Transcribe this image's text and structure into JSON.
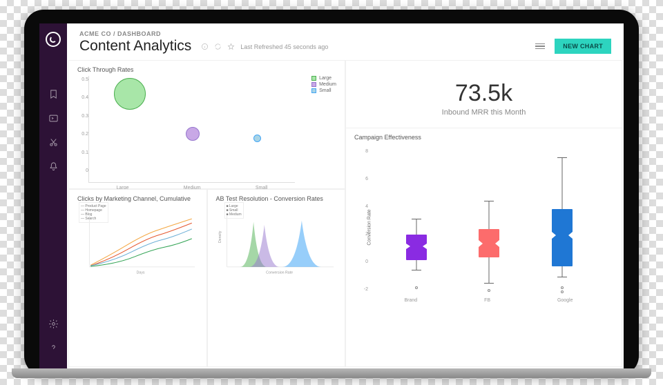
{
  "breadcrumb": {
    "company": "ACME CO",
    "section": "DASHBOARD"
  },
  "title": "Content Analytics",
  "refresh_label": "Last Refreshed 45 seconds ago",
  "new_chart_btn": "NEW CHART",
  "kpi": {
    "value": "73.5k",
    "label": "Inbound MRR this Month"
  },
  "ctr": {
    "title": "Click Through Rates",
    "y_ticks": [
      "0.5",
      "0.4",
      "0.3",
      "0.2",
      "0.1",
      "0"
    ],
    "x_labels": [
      "Large",
      "Medium",
      "Small"
    ],
    "legend": [
      {
        "name": "Large",
        "fill": "#a8e6a8",
        "stroke": "#4caf50"
      },
      {
        "name": "Medium",
        "fill": "#c8a8e6",
        "stroke": "#9575cd"
      },
      {
        "name": "Small",
        "fill": "#a8d4e6",
        "stroke": "#42a5f5"
      }
    ]
  },
  "clicks": {
    "title": "Clicks by Marketing Channel, Cumulative",
    "xlabel": "Days",
    "legend": [
      "Product Page",
      "Homepage",
      "Blog",
      "Search"
    ]
  },
  "abtest": {
    "title": "AB Test Resolution - Conversion Rates",
    "xlabel": "Conversion Rate",
    "legend": [
      "Large",
      "Small",
      "Medium"
    ]
  },
  "campaign": {
    "title": "Campaign Effectiveness",
    "y_label": "Conversion Rate",
    "y_ticks": [
      "8",
      "6",
      "4",
      "2",
      "0",
      "-2"
    ],
    "x_labels": [
      "Brand",
      "FB",
      "Google"
    ]
  },
  "chart_data": [
    {
      "type": "scatter",
      "title": "Click Through Rates",
      "x": [
        "Large",
        "Medium",
        "Small"
      ],
      "y": [
        0.44,
        0.24,
        0.21
      ],
      "sizes": [
        50,
        22,
        12
      ],
      "ylim": [
        0,
        0.5
      ]
    },
    {
      "type": "line",
      "title": "Clicks by Marketing Channel, Cumulative",
      "series": [
        {
          "name": "Product Page",
          "color": "#f4a742",
          "values": [
            600,
            1200,
            2100,
            2800,
            3400,
            4300,
            5100,
            5600,
            6200
          ]
        },
        {
          "name": "Homepage",
          "color": "#e4572e",
          "values": [
            500,
            1000,
            1700,
            2300,
            2800,
            3500,
            4200,
            4700,
            5200
          ]
        },
        {
          "name": "Blog",
          "color": "#6baed6",
          "values": [
            400,
            850,
            1300,
            1800,
            2200,
            2800,
            3400,
            3900,
            4400
          ]
        },
        {
          "name": "Search",
          "color": "#31a354",
          "values": [
            200,
            500,
            900,
            1200,
            1500,
            2000,
            2500,
            2900,
            3300
          ]
        }
      ],
      "xlabel": "Days",
      "ylim": [
        0,
        6500
      ]
    },
    {
      "type": "area",
      "title": "AB Test Resolution - Conversion Rates",
      "xlabel": "Conversion Rate",
      "series": [
        {
          "name": "Large",
          "color": "#4caf50",
          "peak_x": 0.015
        },
        {
          "name": "Small",
          "color": "#9575cd",
          "peak_x": 0.02
        },
        {
          "name": "Medium",
          "color": "#42a5f5",
          "peak_x": 0.035
        }
      ],
      "xlim": [
        0,
        0.05
      ]
    },
    {
      "type": "boxplot",
      "title": "Campaign Effectiveness",
      "ylabel": "Conversion Rate",
      "categories": [
        "Brand",
        "FB",
        "Google"
      ],
      "series": [
        {
          "name": "Brand",
          "color": "#8a2be2",
          "min": -1.2,
          "q1": 0.4,
          "median": 1.0,
          "q3": 1.8,
          "max": 3.1,
          "outliers": [
            -2.3
          ]
        },
        {
          "name": "FB",
          "color": "#fc6c6c",
          "min": -2.4,
          "q1": 0.0,
          "median": 1.0,
          "q3": 2.3,
          "max": 4.7,
          "outliers": [
            -2.8
          ]
        },
        {
          "name": "Google",
          "color": "#1f77d4",
          "min": -1.8,
          "q1": 1.0,
          "median": 2.5,
          "q3": 4.0,
          "max": 8.3,
          "outliers": [
            -2.6,
            -2.8
          ]
        }
      ],
      "ylim": [
        -3,
        9
      ]
    }
  ]
}
